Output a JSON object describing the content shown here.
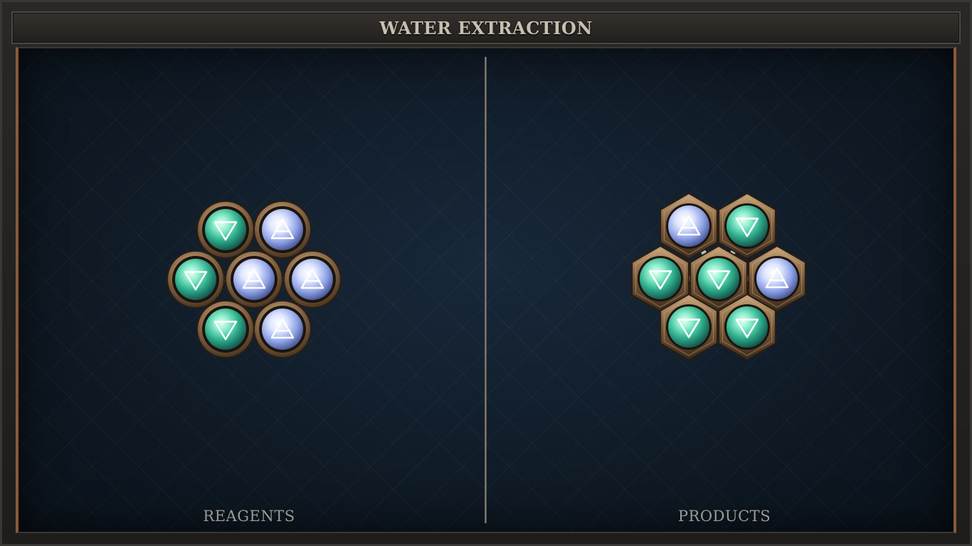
{
  "title": "WATER EXTRACTION",
  "sections": {
    "reagents": {
      "label": "REAGENTS"
    },
    "products": {
      "label": "PRODUCTS"
    }
  },
  "reagents_cluster": {
    "style": "rings",
    "slots": [
      {
        "element": "air",
        "symbol": "air-icon",
        "color": "blue-white"
      },
      {
        "element": "water",
        "symbol": "water-icon",
        "color": "teal"
      },
      {
        "element": "air",
        "symbol": "air-icon",
        "color": "blue-white"
      },
      {
        "element": "water",
        "symbol": "water-icon",
        "color": "teal"
      },
      {
        "element": "air",
        "symbol": "air-icon",
        "color": "blue-white"
      },
      {
        "element": "water",
        "symbol": "water-icon",
        "color": "teal"
      },
      {
        "element": "air",
        "symbol": "air-icon",
        "color": "blue-white"
      }
    ]
  },
  "products_cluster": {
    "style": "hexagons",
    "slots": [
      {
        "element": "water",
        "symbol": "water-icon",
        "color": "teal"
      },
      {
        "element": "air",
        "symbol": "air-icon",
        "color": "blue-white"
      },
      {
        "element": "water",
        "symbol": "water-icon",
        "color": "teal"
      },
      {
        "element": "water",
        "symbol": "water-icon",
        "color": "teal"
      },
      {
        "element": "air",
        "symbol": "air-icon",
        "color": "blue-white"
      },
      {
        "element": "water",
        "symbol": "water-icon",
        "color": "teal"
      },
      {
        "element": "water",
        "symbol": "water-icon",
        "color": "teal"
      }
    ]
  },
  "colors": {
    "teal_orb": "#3fc7a0",
    "air_orb": "#b8c6f0",
    "bronze": "#8a6a48",
    "accent_border": "#8a5a36"
  }
}
